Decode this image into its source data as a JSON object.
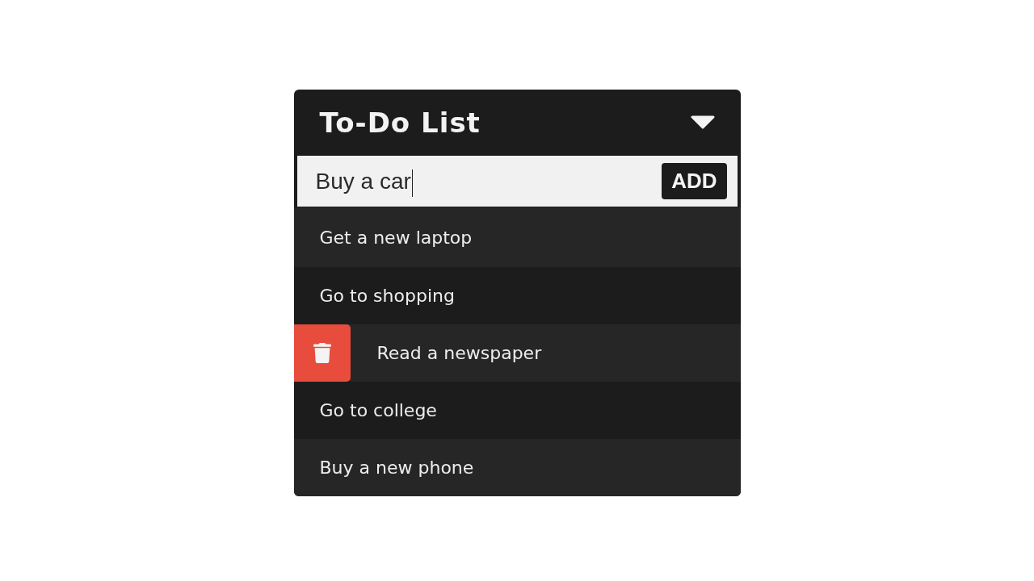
{
  "header": {
    "title": "To-Do List",
    "expanded": true
  },
  "new_task": {
    "value": "Buy a car",
    "focused": true,
    "button": "ADD"
  },
  "tasks": [
    {
      "text": "Get a new laptop",
      "hovered": false
    },
    {
      "text": "Go to shopping",
      "hovered": false
    },
    {
      "text": "Read a newspaper",
      "hovered": true
    },
    {
      "text": "Go to college",
      "hovered": false
    },
    {
      "text": "Buy a new phone",
      "hovered": false
    }
  ]
}
